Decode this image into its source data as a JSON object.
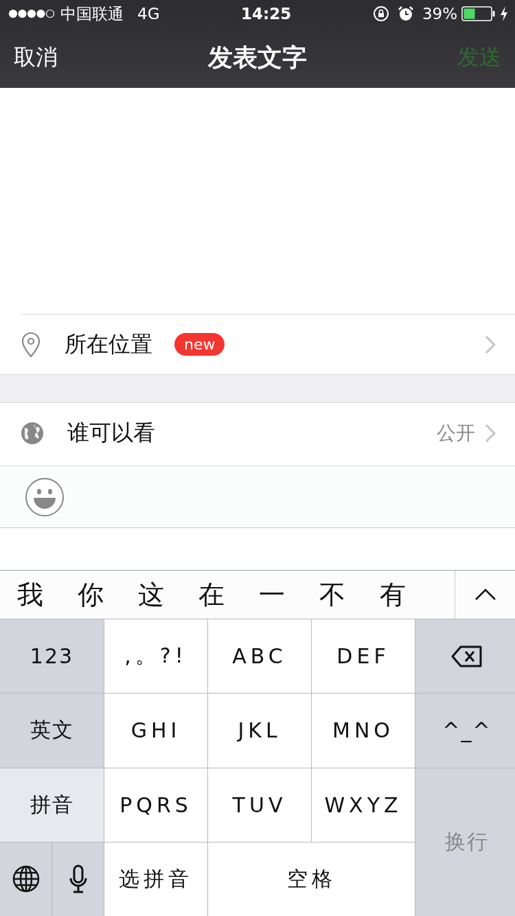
{
  "status_bar": {
    "carrier": "中国联通",
    "network": "4G",
    "time": "14:25",
    "battery_percent": "39%"
  },
  "nav": {
    "cancel": {
      "label": "取消",
      "disabled": false
    },
    "title": "发表文字",
    "send": {
      "label": "发送",
      "disabled": true
    }
  },
  "location_row": {
    "label": "所在位置",
    "badge": "new"
  },
  "visibility_row": {
    "label": "谁可以看",
    "value": "公开"
  },
  "candidates": [
    "我",
    "你",
    "这",
    "在",
    "一",
    "不",
    "有"
  ],
  "keyboard": [
    {
      "kind": "text",
      "label": "123",
      "function": true,
      "selected": false,
      "disabled": false
    },
    {
      "kind": "text",
      "label": ",。?!",
      "function": false,
      "selected": false,
      "disabled": false
    },
    {
      "kind": "text",
      "label": "ABC",
      "function": false,
      "selected": false,
      "disabled": false
    },
    {
      "kind": "text",
      "label": "DEF",
      "function": false,
      "selected": false,
      "disabled": false
    },
    {
      "kind": "delete",
      "function": true,
      "selected": false,
      "disabled": false
    },
    {
      "kind": "text",
      "label": "英文",
      "function": true,
      "selected": false,
      "disabled": false
    },
    {
      "kind": "text",
      "label": "GHI",
      "function": false,
      "selected": false,
      "disabled": false
    },
    {
      "kind": "text",
      "label": "JKL",
      "function": false,
      "selected": false,
      "disabled": false
    },
    {
      "kind": "text",
      "label": "MNO",
      "function": false,
      "selected": false,
      "disabled": false
    },
    {
      "kind": "text",
      "label": "^_^",
      "function": true,
      "selected": false,
      "disabled": false
    },
    {
      "kind": "text",
      "label": "拼音",
      "function": true,
      "selected": true,
      "disabled": false
    },
    {
      "kind": "text",
      "label": "PQRS",
      "function": false,
      "selected": false,
      "disabled": false
    },
    {
      "kind": "text",
      "label": "TUV",
      "function": false,
      "selected": false,
      "disabled": false
    },
    {
      "kind": "text",
      "label": "WXYZ",
      "function": false,
      "selected": false,
      "disabled": false
    },
    {
      "kind": "text",
      "label": "换行",
      "function": true,
      "selected": false,
      "disabled": true
    },
    {
      "kind": "globe",
      "function": true,
      "selected": false,
      "disabled": false
    },
    {
      "kind": "mic",
      "function": true,
      "selected": false,
      "disabled": false
    },
    {
      "kind": "text",
      "label": "选拼音",
      "function": false,
      "selected": false,
      "disabled": false
    },
    {
      "kind": "text",
      "label": "空格",
      "function": false,
      "selected": false,
      "disabled": false
    }
  ]
}
